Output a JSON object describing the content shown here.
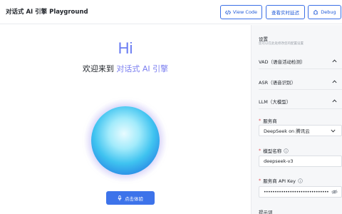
{
  "header": {
    "title": "对话式 AI 引擎 Playground",
    "view_code_label": "View Code",
    "view_delay_label": "查看实时延迟",
    "debug_label": "Debug"
  },
  "main": {
    "greeting": "Hi",
    "welcome_prefix": "欢迎来到 ",
    "welcome_accent": "对话式 AI 引擎",
    "start_button_label": "点击体验"
  },
  "settings": {
    "title": "设置",
    "subtitle": "您可以在此处修改您的配置设置",
    "sections": {
      "vad": "VAD（语音活动检测）",
      "asr": "ASR（语音识别）",
      "llm": "LLM（大模型）"
    },
    "provider_label": "服务商",
    "provider_value": "DeepSeek on 腾讯云",
    "model_label": "模型名称",
    "model_value": "deepseek-v3",
    "api_key_label": "服务商 API Key",
    "api_key_value": "••••••••••••••••••••••••••••••••••••••••",
    "prompt_label": "提示词",
    "required_mark": "*"
  },
  "colors": {
    "accent": "#3d73ea",
    "greeting": "#6a7cf2",
    "required": "#e5484d"
  },
  "icons": {
    "code": "code-icon",
    "bug": "bug-icon",
    "mic": "mic-icon",
    "chevron_up": "chevron-up-icon",
    "chevron_down": "chevron-down-icon",
    "info": "info-icon",
    "eye": "eye-off-icon"
  }
}
